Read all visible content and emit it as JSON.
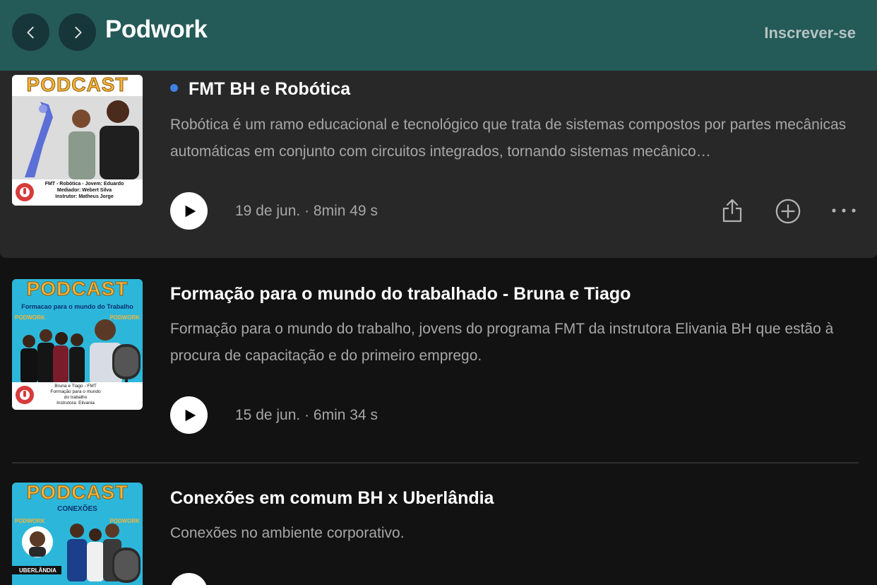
{
  "header": {
    "title": "Podwork",
    "subscribe_label": "Inscrever-se",
    "back_icon": "chevron-left-icon",
    "forward_icon": "chevron-right-icon"
  },
  "episodes": [
    {
      "title": "FMT BH e Robótica",
      "unplayed": true,
      "description": "Robótica é um ramo educacional e tecnológico que trata de sistemas compostos por partes mecânicas automáticas em conjunto com circuitos integrados, tornando sistemas mecânico…",
      "meta": "19 de jun. · 8min 49 s",
      "cover": {
        "label": "PODCAST",
        "caption": "FMT - Robótica - Jovem: Eduardo\nMediador: Webert Silva\nInstrutor: Matheus Jorge"
      }
    },
    {
      "title": "Formação para o mundo do trabalhado - Bruna e Tiago",
      "unplayed": false,
      "description": "Formação para o mundo do trabalho, jovens do programa FMT da instrutora Elivania BH que estão à procura de capacitação e do primeiro emprego.",
      "meta": "15 de jun. · 6min 34 s",
      "cover": {
        "label": "PODCAST",
        "sub": "Formacao para o mundo do Trabalho",
        "tag": "PODWORK",
        "caption": "Bruna e Tiago - FMT\nFormação para o mundo\ndo trabalho\nInstrutora: Elivania"
      }
    },
    {
      "title": "Conexões em comum BH x Uberlândia",
      "unplayed": false,
      "description": "Conexões no ambiente corporativo.",
      "meta": "",
      "cover": {
        "label": "PODCAST",
        "sub": "CONEXÕES",
        "tag": "PODWORK",
        "caption": "UBERLÂNDIA"
      }
    }
  ],
  "actions": {
    "share_icon": "share-icon",
    "add_icon": "plus-circle-icon",
    "more_icon": "more-horizontal-icon"
  },
  "colors": {
    "header_bg": "#245a57",
    "page_bg": "#121212",
    "active_row_bg": "#282828",
    "unplayed_dot": "#3f82e6",
    "secondary_text": "#a7a7a7"
  }
}
